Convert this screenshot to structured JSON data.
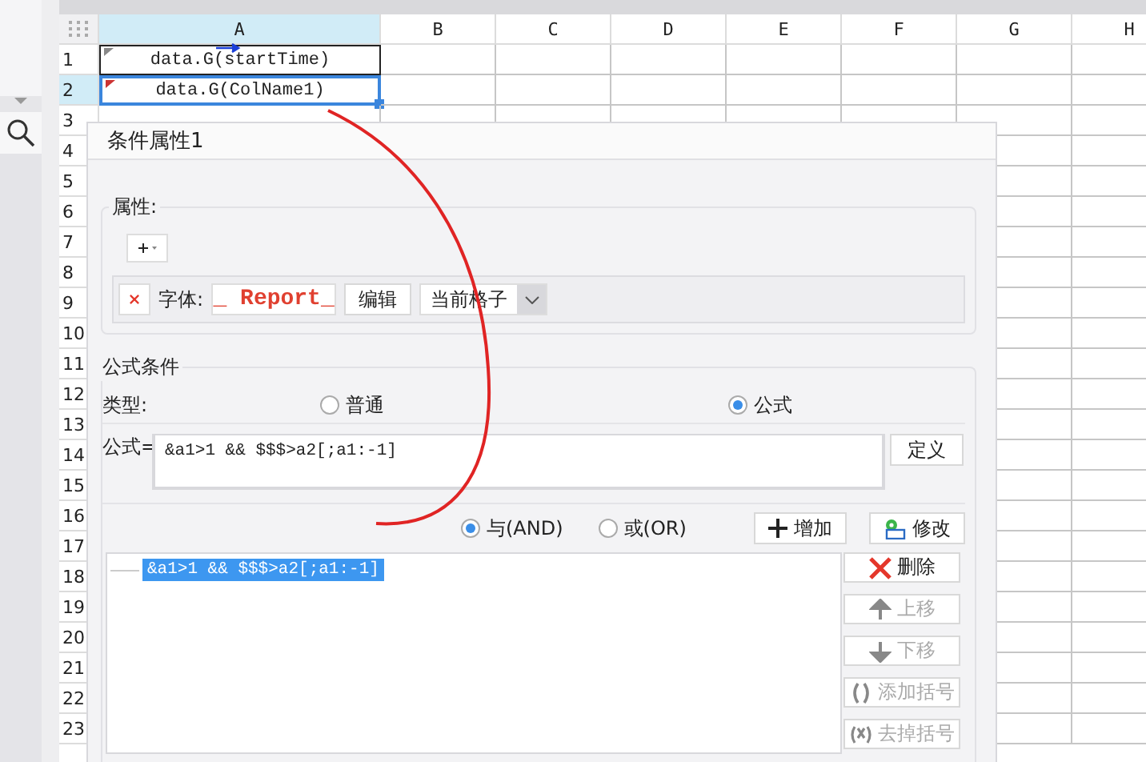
{
  "sheet": {
    "columns": [
      {
        "label": "A",
        "selected": true
      },
      {
        "label": "B",
        "selected": false
      },
      {
        "label": "C",
        "selected": false
      },
      {
        "label": "D",
        "selected": false
      },
      {
        "label": "E",
        "selected": false
      },
      {
        "label": "F",
        "selected": false
      },
      {
        "label": "G",
        "selected": false
      },
      {
        "label": "H",
        "selected": false
      }
    ],
    "rows": [
      {
        "label": "1",
        "selected": false
      },
      {
        "label": "2",
        "selected": true
      },
      {
        "label": "3",
        "selected": false
      },
      {
        "label": "4",
        "selected": false
      },
      {
        "label": "5",
        "selected": false
      },
      {
        "label": "6",
        "selected": false
      },
      {
        "label": "7",
        "selected": false
      },
      {
        "label": "8",
        "selected": false
      },
      {
        "label": "9",
        "selected": false
      },
      {
        "label": "10",
        "selected": false
      },
      {
        "label": "11",
        "selected": false
      },
      {
        "label": "12",
        "selected": false
      },
      {
        "label": "13",
        "selected": false
      },
      {
        "label": "14",
        "selected": false
      },
      {
        "label": "15",
        "selected": false
      },
      {
        "label": "16",
        "selected": false
      },
      {
        "label": "17",
        "selected": false
      },
      {
        "label": "18",
        "selected": false
      },
      {
        "label": "19",
        "selected": false
      },
      {
        "label": "20",
        "selected": false
      },
      {
        "label": "21",
        "selected": false
      },
      {
        "label": "22",
        "selected": false
      },
      {
        "label": "23",
        "selected": false
      }
    ],
    "cells": [
      {
        "text": "data.G(startTime)",
        "selected": false
      },
      {
        "text": "data.G(ColName1)",
        "selected": true
      }
    ]
  },
  "dialog": {
    "title": "条件属性1",
    "attributes": {
      "legend": "属性:",
      "font_label": "字体:",
      "font_preview": "_ Report_",
      "edit_button": "编辑",
      "scope": "当前格子"
    },
    "formula_condition": {
      "legend": "公式条件",
      "type_label": "类型:",
      "type_options": [
        {
          "label": "普通",
          "selected": false
        },
        {
          "label": "公式",
          "selected": true
        }
      ],
      "formula_label": "公式=",
      "formula_value": "&a1>1 && $$$>a2[;a1:-1]",
      "define_button": "定义",
      "logic_options": [
        {
          "label": "与(AND)",
          "selected": true
        },
        {
          "label": "或(OR)",
          "selected": false
        }
      ],
      "add_button": "增加",
      "modify_button": "修改",
      "conditions": [
        {
          "text": "&a1>1 && $$$>a2[;a1:-1]",
          "selected": true
        }
      ],
      "side_buttons": [
        {
          "kind": "delete",
          "label": "删除",
          "disabled": false
        },
        {
          "kind": "up",
          "label": "上移",
          "disabled": true
        },
        {
          "kind": "down",
          "label": "下移",
          "disabled": true
        },
        {
          "kind": "add-bracket",
          "label": "添加括号",
          "disabled": true
        },
        {
          "kind": "remove-bracket",
          "label": "去掉括号",
          "disabled": true
        }
      ]
    }
  }
}
